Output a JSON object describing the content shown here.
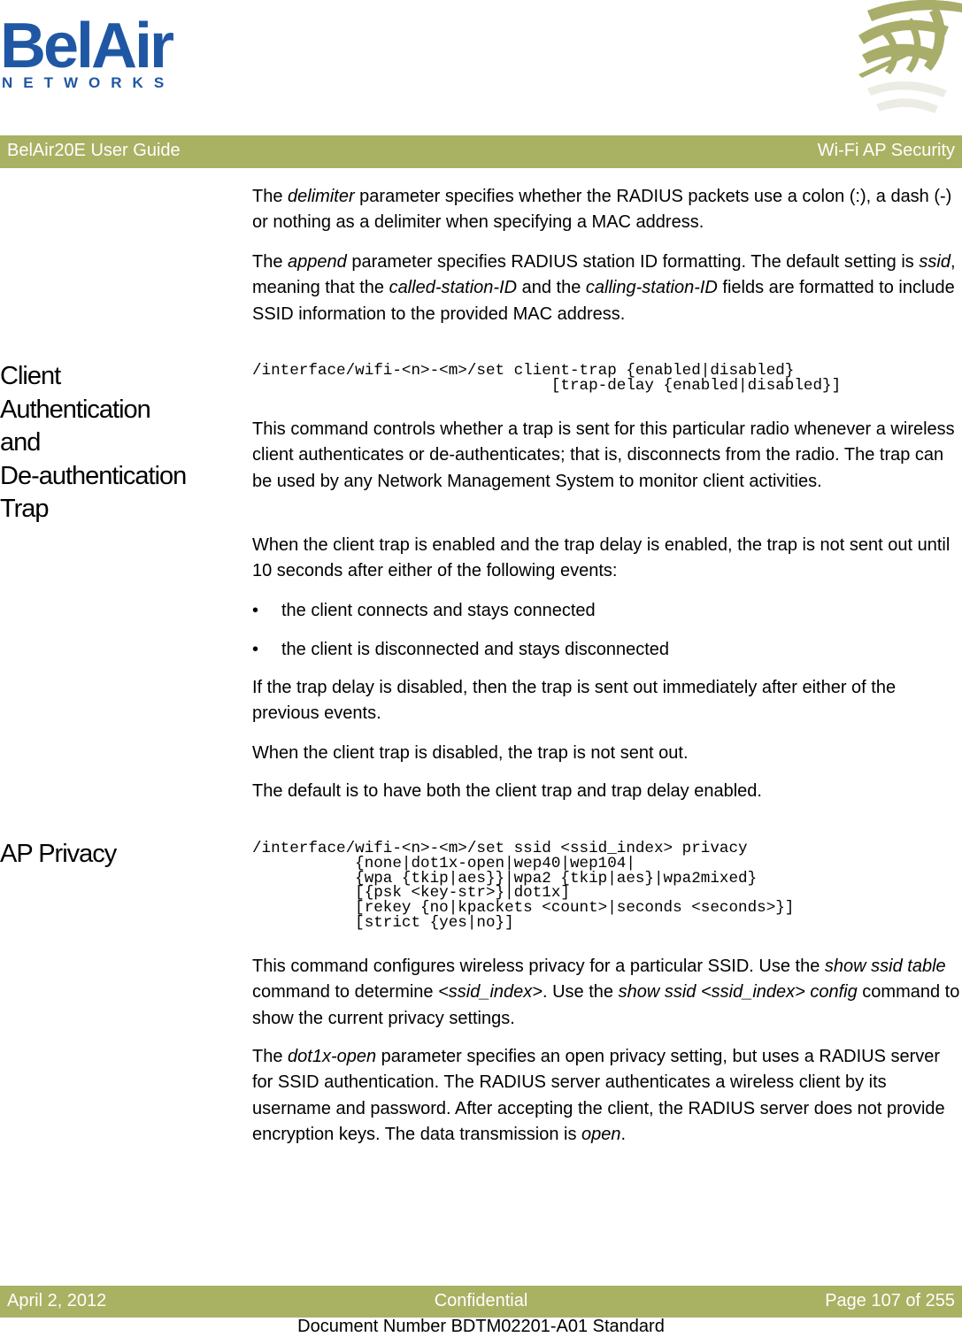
{
  "logo": {
    "brand": "BelAir",
    "sub": "NETWORKS",
    "brand_color": "#1f57a4",
    "accent_color": "#a9b163"
  },
  "header": {
    "left": "BelAir20E User Guide",
    "right": "Wi-Fi AP Security"
  },
  "intro": {
    "p1": {
      "pre": "The ",
      "em": "delimiter",
      "post": " parameter specifies whether the RADIUS packets use a colon (:), a dash (-) or nothing as a delimiter when specifying a MAC address."
    },
    "p2": {
      "t1": "The ",
      "e1": "append",
      "t2": " parameter specifies RADIUS station ID formatting. The default setting is ",
      "e2": "ssid",
      "t3": ", meaning that the ",
      "e3": "called-station-ID",
      "t4": " and the ",
      "e4": "calling-station-ID",
      "t5": " fields are formatted to include SSID information to the provided MAC address."
    }
  },
  "sections": [
    {
      "heading": "Client Authentication and De-authentication Trap",
      "heading_lines": [
        "Client",
        "Authentication",
        "and",
        "De-authentication",
        "Trap"
      ],
      "command": "/interface/wifi-<n>-<m>/set client-trap {enabled|disabled}\n                                [trap-delay {enabled|disabled}]",
      "paragraphs": [
        "This command controls whether a trap is sent for this particular radio whenever a wireless client authenticates or de-authenticates; that is, disconnects from the radio. The trap can be used by any Network Management System to monitor client activities.",
        "When the client trap is enabled and the trap delay is enabled, the trap is not sent out until 10 seconds after either of the following events:"
      ],
      "bullets": [
        "the client connects and stays connected",
        "the client is disconnected and stays disconnected"
      ],
      "after_bullets": [
        "If the trap delay is disabled, then the trap is sent out immediately after either of the previous events.",
        "When the client trap is disabled, the trap is not sent out.",
        "The default is to have both the client trap and trap delay enabled."
      ]
    },
    {
      "heading": "AP Privacy",
      "command": "/interface/wifi-<n>-<m>/set ssid <ssid_index> privacy\n           {none|dot1x-open|wep40|wep104|\n           {wpa {tkip|aes}}|wpa2 {tkip|aes}|wpa2mixed}\n           [{psk <key-str>}|dot1x]\n           [rekey {no|kpackets <count>|seconds <seconds>}]\n           [strict {yes|no}]",
      "p1": {
        "t1": "This command configures wireless privacy for a particular SSID. Use the ",
        "e1": "show ssid table",
        "t2": " command to determine ",
        "e2": "<ssid_index>",
        "t3": ". Use the ",
        "e3": "show ssid <ssid_index> config",
        "t4": " command to show the current privacy settings."
      },
      "p2": {
        "t1": "The ",
        "e1": "dot1x-open",
        "t2": " parameter specifies an open privacy setting, but uses a RADIUS server for SSID authentication. The RADIUS server authenticates a wireless client by its username and password. After accepting the client, the RADIUS server does not provide encryption keys. The data transmission is ",
        "e2": "open",
        "t3": "."
      }
    }
  ],
  "footer": {
    "date": "April 2, 2012",
    "classification": "Confidential",
    "page": "Page 107 of 255",
    "document_number": "Document Number BDTM02201-A01 Standard"
  }
}
